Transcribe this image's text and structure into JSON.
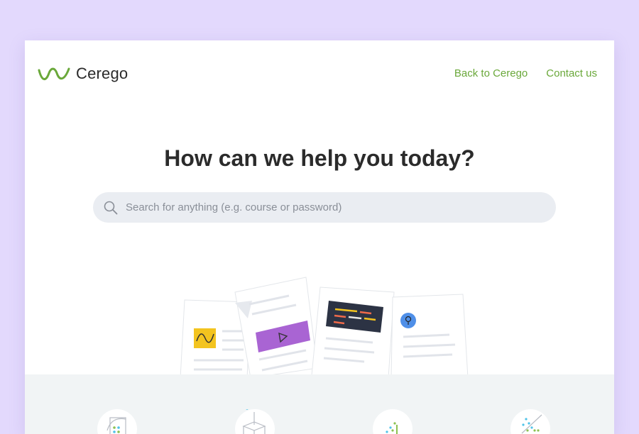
{
  "brand": {
    "name": "Cerego",
    "accent": "#6aa83a",
    "logo_icon": "wave-icon"
  },
  "nav": {
    "back_label": "Back to Cerego",
    "contact_label": "Contact us"
  },
  "hero": {
    "title": "How can we help you today?"
  },
  "search": {
    "placeholder": "Search for anything (e.g. course or password)",
    "value": "",
    "icon": "search-icon"
  },
  "colors": {
    "background": "#e3d9fd",
    "search_bg": "#eaedf2",
    "band_bg": "#f1f4f5",
    "title": "#2b2b2b"
  },
  "categories": [
    {
      "icon": "chart-document-icon"
    },
    {
      "icon": "open-box-icon"
    },
    {
      "icon": "scatter-growth-icon"
    },
    {
      "icon": "network-icon"
    }
  ]
}
